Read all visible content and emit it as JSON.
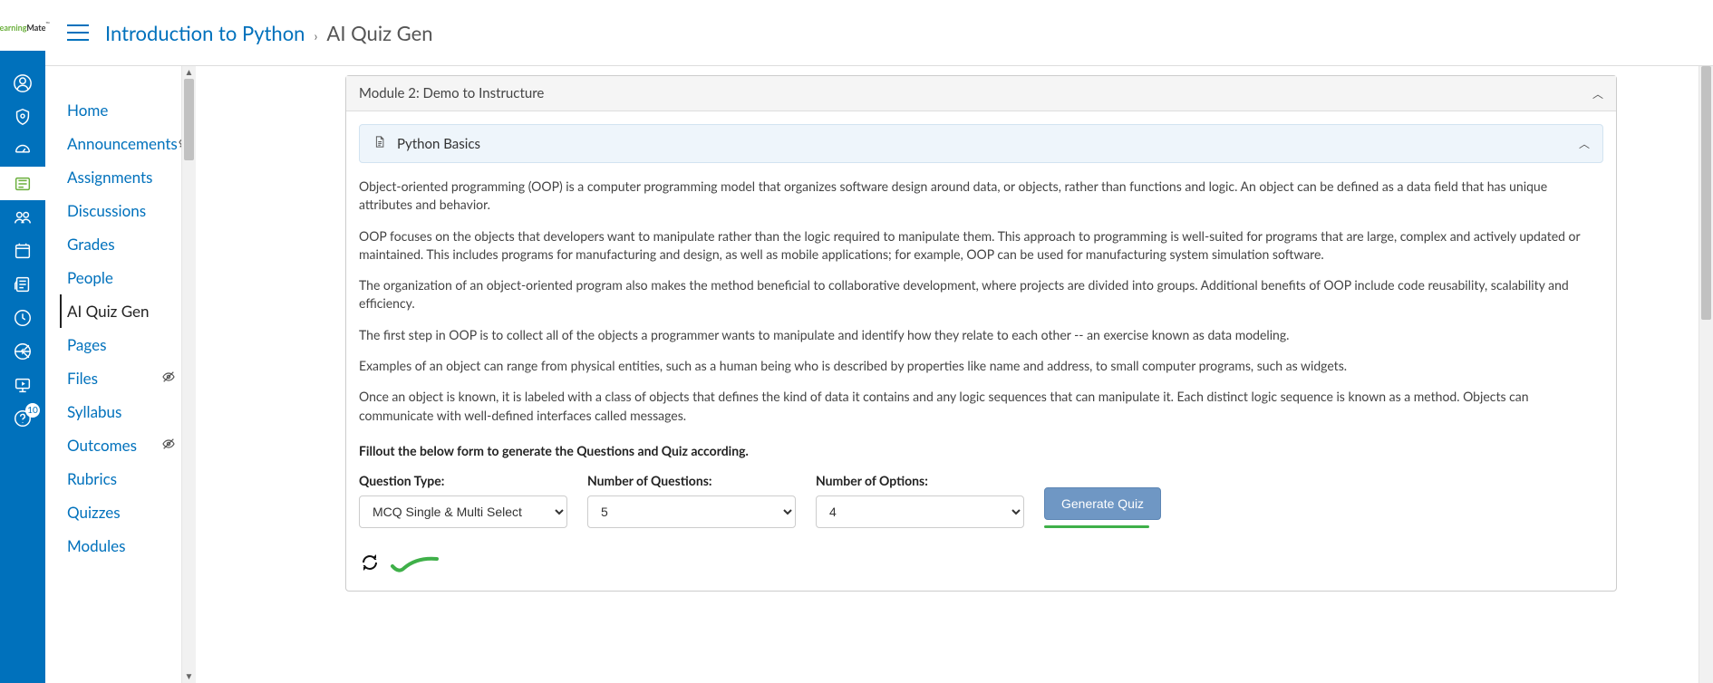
{
  "logo": {
    "part1": "Learning",
    "part2": "Mate",
    "tm": "™"
  },
  "rail_badge": "10",
  "breadcrumb": {
    "course": "Introduction to Python",
    "separator": "›",
    "current": "AI Quiz Gen"
  },
  "nav": {
    "items": [
      {
        "label": "Home",
        "active": false,
        "hidden": false
      },
      {
        "label": "Announcements",
        "active": false,
        "hidden": true
      },
      {
        "label": "Assignments",
        "active": false,
        "hidden": false
      },
      {
        "label": "Discussions",
        "active": false,
        "hidden": false
      },
      {
        "label": "Grades",
        "active": false,
        "hidden": false
      },
      {
        "label": "People",
        "active": false,
        "hidden": false
      },
      {
        "label": "AI Quiz Gen",
        "active": true,
        "hidden": false
      },
      {
        "label": "Pages",
        "active": false,
        "hidden": false
      },
      {
        "label": "Files",
        "active": false,
        "hidden": true
      },
      {
        "label": "Syllabus",
        "active": false,
        "hidden": false
      },
      {
        "label": "Outcomes",
        "active": false,
        "hidden": true
      },
      {
        "label": "Rubrics",
        "active": false,
        "hidden": false
      },
      {
        "label": "Quizzes",
        "active": false,
        "hidden": false
      },
      {
        "label": "Modules",
        "active": false,
        "hidden": false
      }
    ]
  },
  "module": {
    "title": "Module 2: Demo to Instructure"
  },
  "topic": {
    "title": "Python Basics"
  },
  "passage": {
    "p1": "Object-oriented programming (OOP) is a computer programming model that organizes software design around data, or objects, rather than functions and logic. An object can be defined as a data field that has unique attributes and behavior.",
    "p2": "OOP focuses on the objects that developers want to manipulate rather than the logic required to manipulate them. This approach to programming is well-suited for programs that are large, complex and actively updated or maintained. This includes programs for manufacturing and design, as well as mobile applications; for example, OOP can be used for manufacturing system simulation software.",
    "p3": "The organization of an object-oriented program also makes the method beneficial to collaborative development, where projects are divided into groups. Additional benefits of OOP include code reusability, scalability and efficiency.",
    "p4": "The first step in OOP is to collect all of the objects a programmer wants to manipulate and identify how they relate to each other -- an exercise known as data modeling.",
    "p5": "Examples of an object can range from physical entities, such as a human being who is described by properties like name and address, to small computer programs, such as widgets.",
    "p6": "Once an object is known, it is labeled with a class of objects that defines the kind of data it contains and any logic sequences that can manipulate it. Each distinct logic sequence is known as a method. Objects can communicate with well-defined interfaces called messages."
  },
  "form": {
    "instruction": "Fillout the below form to generate the Questions and Quiz according.",
    "question_type_label": "Question Type:",
    "question_type_value": "MCQ Single & Multi Select",
    "num_questions_label": "Number of Questions:",
    "num_questions_value": "5",
    "num_options_label": "Number of Options:",
    "num_options_value": "4",
    "generate_button": "Generate Quiz"
  }
}
